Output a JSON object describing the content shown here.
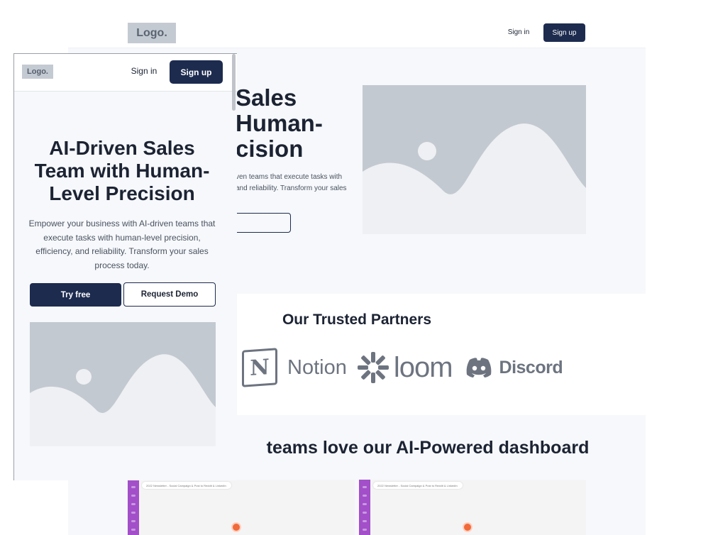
{
  "desktop": {
    "nav": {
      "logo": "Logo.",
      "signin": "Sign in",
      "signup": "Sign up"
    },
    "hero": {
      "heading": "Sales\n Human-\ncision",
      "paragraph": "ven teams that execute tasks with\nand reliability. Transform your sales",
      "image_icon": "image-placeholder-icon"
    },
    "partners": {
      "title": "Our Trusted Partners",
      "logos": [
        {
          "name": "Notion",
          "icon": "notion-icon"
        },
        {
          "name": "loom",
          "icon": "loom-icon"
        },
        {
          "name": "Discord",
          "icon": "discord-icon"
        }
      ]
    },
    "dashboard": {
      "title": "teams love our AI-Powered dashboard",
      "screenshot_tab": "2022 Newsletter - Social Campaign & Post to Reddit & LinkedIn"
    }
  },
  "mobile": {
    "nav": {
      "logo": "Logo.",
      "signin": "Sign in",
      "signup": "Sign up"
    },
    "hero": {
      "heading": "AI-Driven Sales Team with Human-Level Precision",
      "paragraph": "Empower your business with AI-driven teams that execute tasks with human-level precision, efficiency, and reliability. Transform your sales process today.",
      "try_free": "Try free",
      "request_demo": "Request Demo",
      "image_icon": "image-placeholder-icon"
    }
  },
  "colors": {
    "primary": "#1d2b4f",
    "hero_bg": "#f6f8fb",
    "placeholder": "#c3c9d0",
    "partner_logo": "#6d7480",
    "dashboard_sidebar": "#a34fc9"
  }
}
